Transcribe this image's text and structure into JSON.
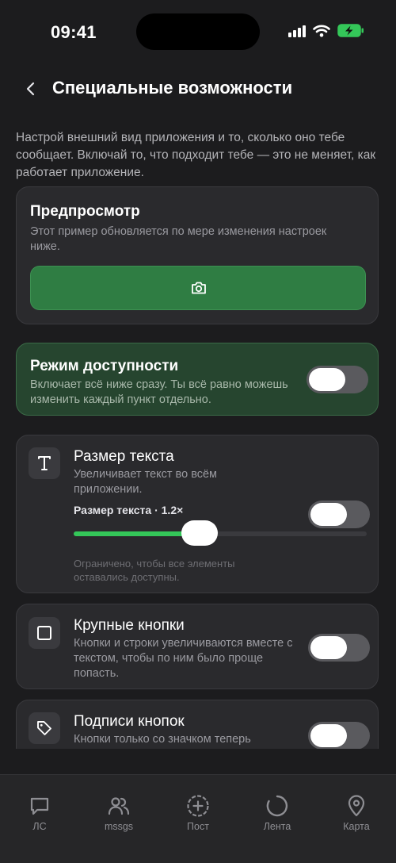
{
  "status": {
    "time": "09:41"
  },
  "header": {
    "title": "Специальные возможности"
  },
  "intro": "Настрой внешний вид приложения и то, сколько оно тебе сообщает. Включай то, что подходит тебе — это не меняет, как работает приложение.",
  "preview": {
    "title": "Предпросмотр",
    "description": "Этот пример обновляется по мере изменения настроек ниже.",
    "button_icon": "camera-icon"
  },
  "accessibility_mode": {
    "title": "Режим доступности",
    "description": "Включает всё ниже сразу. Ты всё равно можешь изменить каждый пункт отдельно.",
    "enabled": false
  },
  "text_size": {
    "title": "Размер текста",
    "description": "Увеличивает текст во всём приложении.",
    "control_label": "Размер текста · 1.2×",
    "slider_fraction": 0.43,
    "note": "Ограничено, чтобы все элементы оставались доступны.",
    "icon": "text-size-icon",
    "enabled": false
  },
  "large_buttons": {
    "title": "Крупные кнопки",
    "description": "Кнопки и строки увеличиваются вместе с текстом, чтобы по ним было проще попасть.",
    "icon": "square-icon",
    "enabled": false
  },
  "button_labels": {
    "title": "Подписи кнопок",
    "description": "Кнопки только со значком теперь",
    "icon": "tag-icon",
    "enabled": false
  },
  "tabbar": {
    "items": [
      {
        "label": "ЛС",
        "icon": "chat-icon"
      },
      {
        "label": "mssgs",
        "icon": "people-icon"
      },
      {
        "label": "Пост",
        "icon": "plus-circle-icon"
      },
      {
        "label": "Лента",
        "icon": "circle-icon"
      },
      {
        "label": "Карта",
        "icon": "map-pin-icon"
      }
    ]
  },
  "colors": {
    "accent": "#34c759",
    "preview_button": "#2f7d43",
    "background": "#1c1c1e"
  }
}
